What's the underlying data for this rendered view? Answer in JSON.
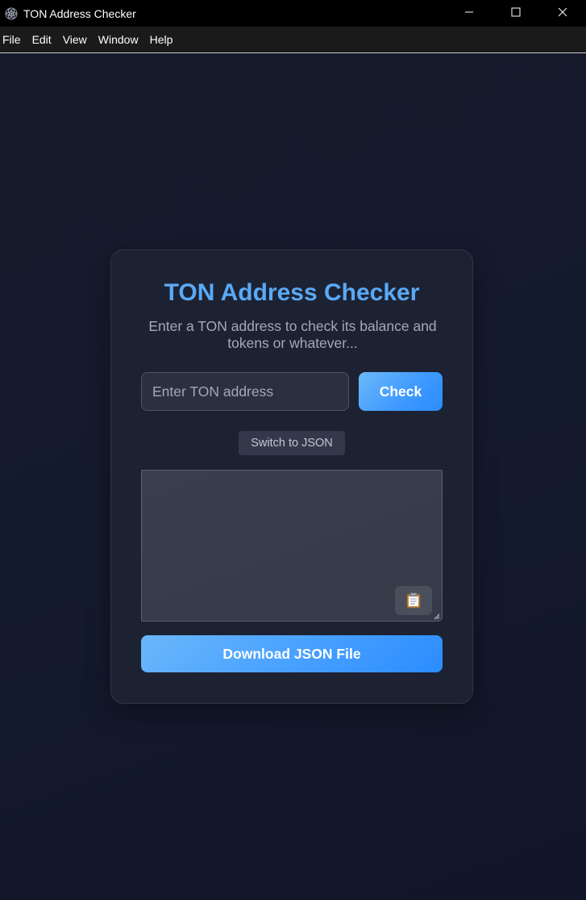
{
  "window": {
    "title": "TON Address Checker"
  },
  "menu": {
    "items": [
      {
        "label": "File"
      },
      {
        "label": "Edit"
      },
      {
        "label": "View"
      },
      {
        "label": "Window"
      },
      {
        "label": "Help"
      }
    ]
  },
  "card": {
    "title": "TON Address Checker",
    "subtitle": "Enter a TON address to check its balance and tokens or whatever...",
    "address_input": {
      "value": "",
      "placeholder": "Enter TON address"
    },
    "check_label": "Check",
    "switch_label": "Switch to JSON",
    "json_output": {
      "value": ""
    },
    "copy_icon": "clipboard-icon",
    "download_label": "Download JSON File"
  },
  "colors": {
    "accent": "#5aa9f5",
    "button_gradient_start": "#6cb8fa",
    "button_gradient_end": "#2c8cff",
    "background": "#12172a",
    "card": "#1d2233"
  }
}
